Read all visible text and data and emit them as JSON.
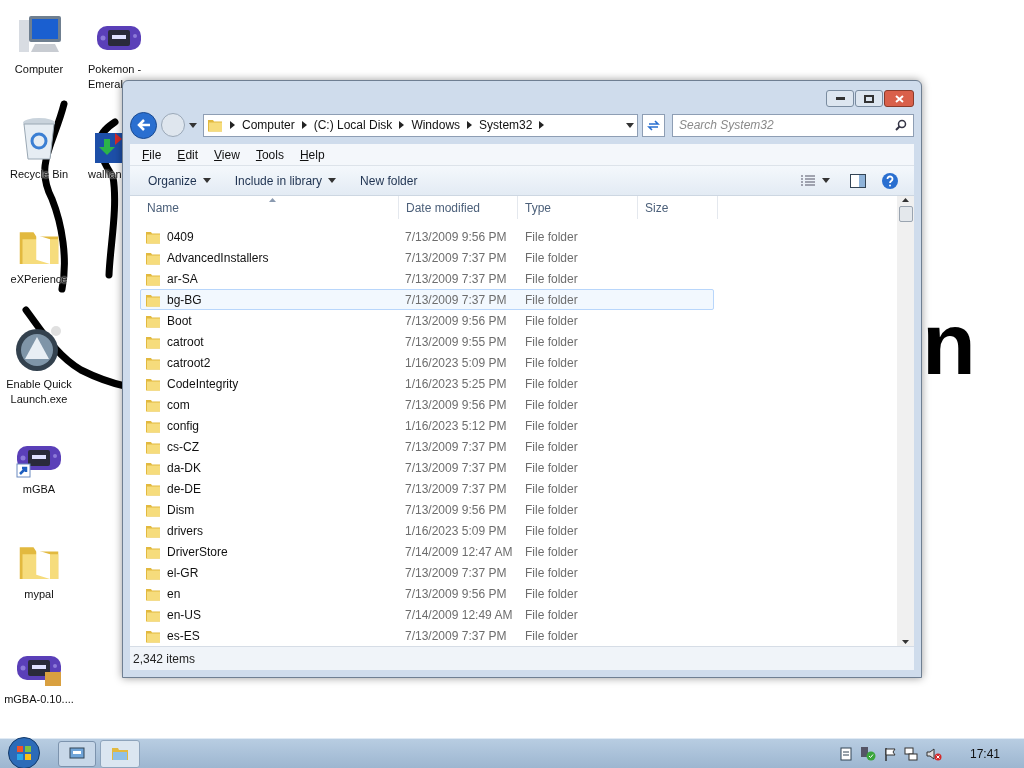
{
  "desktop": {
    "columns": [
      [
        {
          "kind": "computer",
          "lines": [
            "Computer"
          ]
        },
        {
          "kind": "recycle",
          "lines": [
            "Recycle Bin"
          ]
        },
        {
          "kind": "folder",
          "lines": [
            "eXPerience"
          ]
        },
        {
          "kind": "aimp",
          "lines": [
            "Enable Quick",
            "Launch.exe"
          ]
        },
        {
          "kind": "gba-shortcut",
          "lines": [
            "mGBA"
          ]
        },
        {
          "kind": "folder",
          "lines": [
            "mypal"
          ]
        },
        {
          "kind": "gba-archive",
          "lines": [
            "mGBA-0.10...."
          ]
        }
      ],
      [
        {
          "kind": "gba",
          "lines": [
            "Pokemon -",
            "Emeral"
          ]
        },
        {
          "kind": "installer",
          "lines": [
            "wallian"
          ]
        }
      ]
    ],
    "handwriting": "n"
  },
  "window": {
    "address": [
      "Computer",
      "(C:) Local Disk",
      "Windows",
      "System32"
    ],
    "search": {
      "placeholder": "Search System32"
    },
    "menu": [
      "File",
      "Edit",
      "View",
      "Tools",
      "Help"
    ],
    "toolbar": [
      {
        "label": "Organize",
        "dropdown": true
      },
      {
        "label": "Include in library",
        "dropdown": true
      },
      {
        "label": "New folder",
        "dropdown": false
      }
    ],
    "columns": [
      {
        "label": "Name",
        "sorted": true
      },
      {
        "label": "Date modified",
        "sorted": false
      },
      {
        "label": "Type",
        "sorted": false
      },
      {
        "label": "Size",
        "sorted": false
      }
    ],
    "rows": [
      {
        "name": "0409",
        "date": "7/13/2009 9:56 PM",
        "type": "File folder",
        "selected": false
      },
      {
        "name": "AdvancedInstallers",
        "date": "7/13/2009 7:37 PM",
        "type": "File folder",
        "selected": false
      },
      {
        "name": "ar-SA",
        "date": "7/13/2009 7:37 PM",
        "type": "File folder",
        "selected": false
      },
      {
        "name": "bg-BG",
        "date": "7/13/2009 7:37 PM",
        "type": "File folder",
        "selected": true
      },
      {
        "name": "Boot",
        "date": "7/13/2009 9:56 PM",
        "type": "File folder",
        "selected": false
      },
      {
        "name": "catroot",
        "date": "7/13/2009 9:55 PM",
        "type": "File folder",
        "selected": false
      },
      {
        "name": "catroot2",
        "date": "1/16/2023 5:09 PM",
        "type": "File folder",
        "selected": false
      },
      {
        "name": "CodeIntegrity",
        "date": "1/16/2023 5:25 PM",
        "type": "File folder",
        "selected": false
      },
      {
        "name": "com",
        "date": "7/13/2009 9:56 PM",
        "type": "File folder",
        "selected": false
      },
      {
        "name": "config",
        "date": "1/16/2023 5:12 PM",
        "type": "File folder",
        "selected": false
      },
      {
        "name": "cs-CZ",
        "date": "7/13/2009 7:37 PM",
        "type": "File folder",
        "selected": false
      },
      {
        "name": "da-DK",
        "date": "7/13/2009 7:37 PM",
        "type": "File folder",
        "selected": false
      },
      {
        "name": "de-DE",
        "date": "7/13/2009 7:37 PM",
        "type": "File folder",
        "selected": false
      },
      {
        "name": "Dism",
        "date": "7/13/2009 9:56 PM",
        "type": "File folder",
        "selected": false
      },
      {
        "name": "drivers",
        "date": "1/16/2023 5:09 PM",
        "type": "File folder",
        "selected": false
      },
      {
        "name": "DriverStore",
        "date": "7/14/2009 12:47 AM",
        "type": "File folder",
        "selected": false
      },
      {
        "name": "el-GR",
        "date": "7/13/2009 7:37 PM",
        "type": "File folder",
        "selected": false
      },
      {
        "name": "en",
        "date": "7/13/2009 9:56 PM",
        "type": "File folder",
        "selected": false
      },
      {
        "name": "en-US",
        "date": "7/14/2009 12:49 AM",
        "type": "File folder",
        "selected": false
      },
      {
        "name": "es-ES",
        "date": "7/13/2009 7:37 PM",
        "type": "File folder",
        "selected": false
      }
    ],
    "status": "2,342 items"
  },
  "taskbar": {
    "clock": "17:41"
  }
}
